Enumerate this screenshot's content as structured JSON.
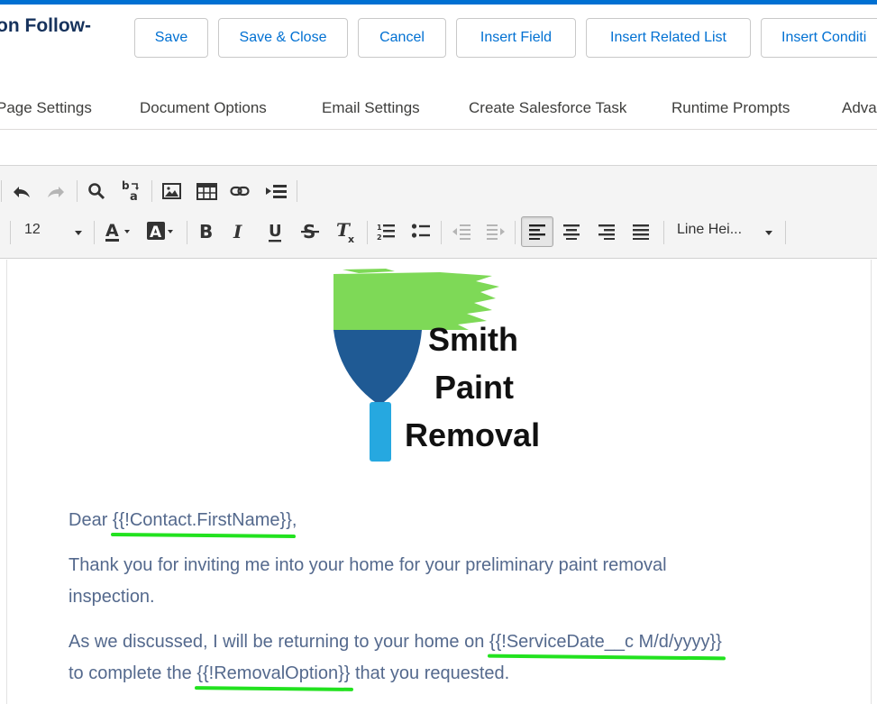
{
  "header": {
    "title": "on Follow-",
    "buttons": [
      "Save",
      "Save & Close",
      "Cancel",
      "Insert Field",
      "Insert Related List",
      "Insert Conditi"
    ]
  },
  "tabs": [
    "Page Settings",
    "Document Options",
    "Email Settings",
    "Create Salesforce Task",
    "Runtime Prompts",
    "Adva"
  ],
  "toolbar": {
    "font_size": "12",
    "line_height_label": "Line Hei..."
  },
  "logo": {
    "line1": "Smith",
    "line2": "Paint",
    "line3": "Removal",
    "colors": {
      "green": "#7ed957",
      "blue": "#1f5a94",
      "cyan": "#26a8e0"
    }
  },
  "document": {
    "greeting_prefix": "Dear ",
    "greeting_field": "{{!Contact.FirstName}}",
    "greeting_suffix": ",",
    "para1": "Thank you for inviting me into your home for your preliminary paint removal inspection.",
    "para2_prefix": "As we discussed, I will be returning to your home on ",
    "para2_field1": "{{!ServiceDate__c M/d/yyyy}}",
    "para2_middle": "to complete the ",
    "para2_field2": "{{!RemovalOption}}",
    "para2_suffix": " that you requested."
  },
  "colors": {
    "accent": "#0070d2",
    "highlight": "#22e21f",
    "body_text": "#54698d"
  }
}
